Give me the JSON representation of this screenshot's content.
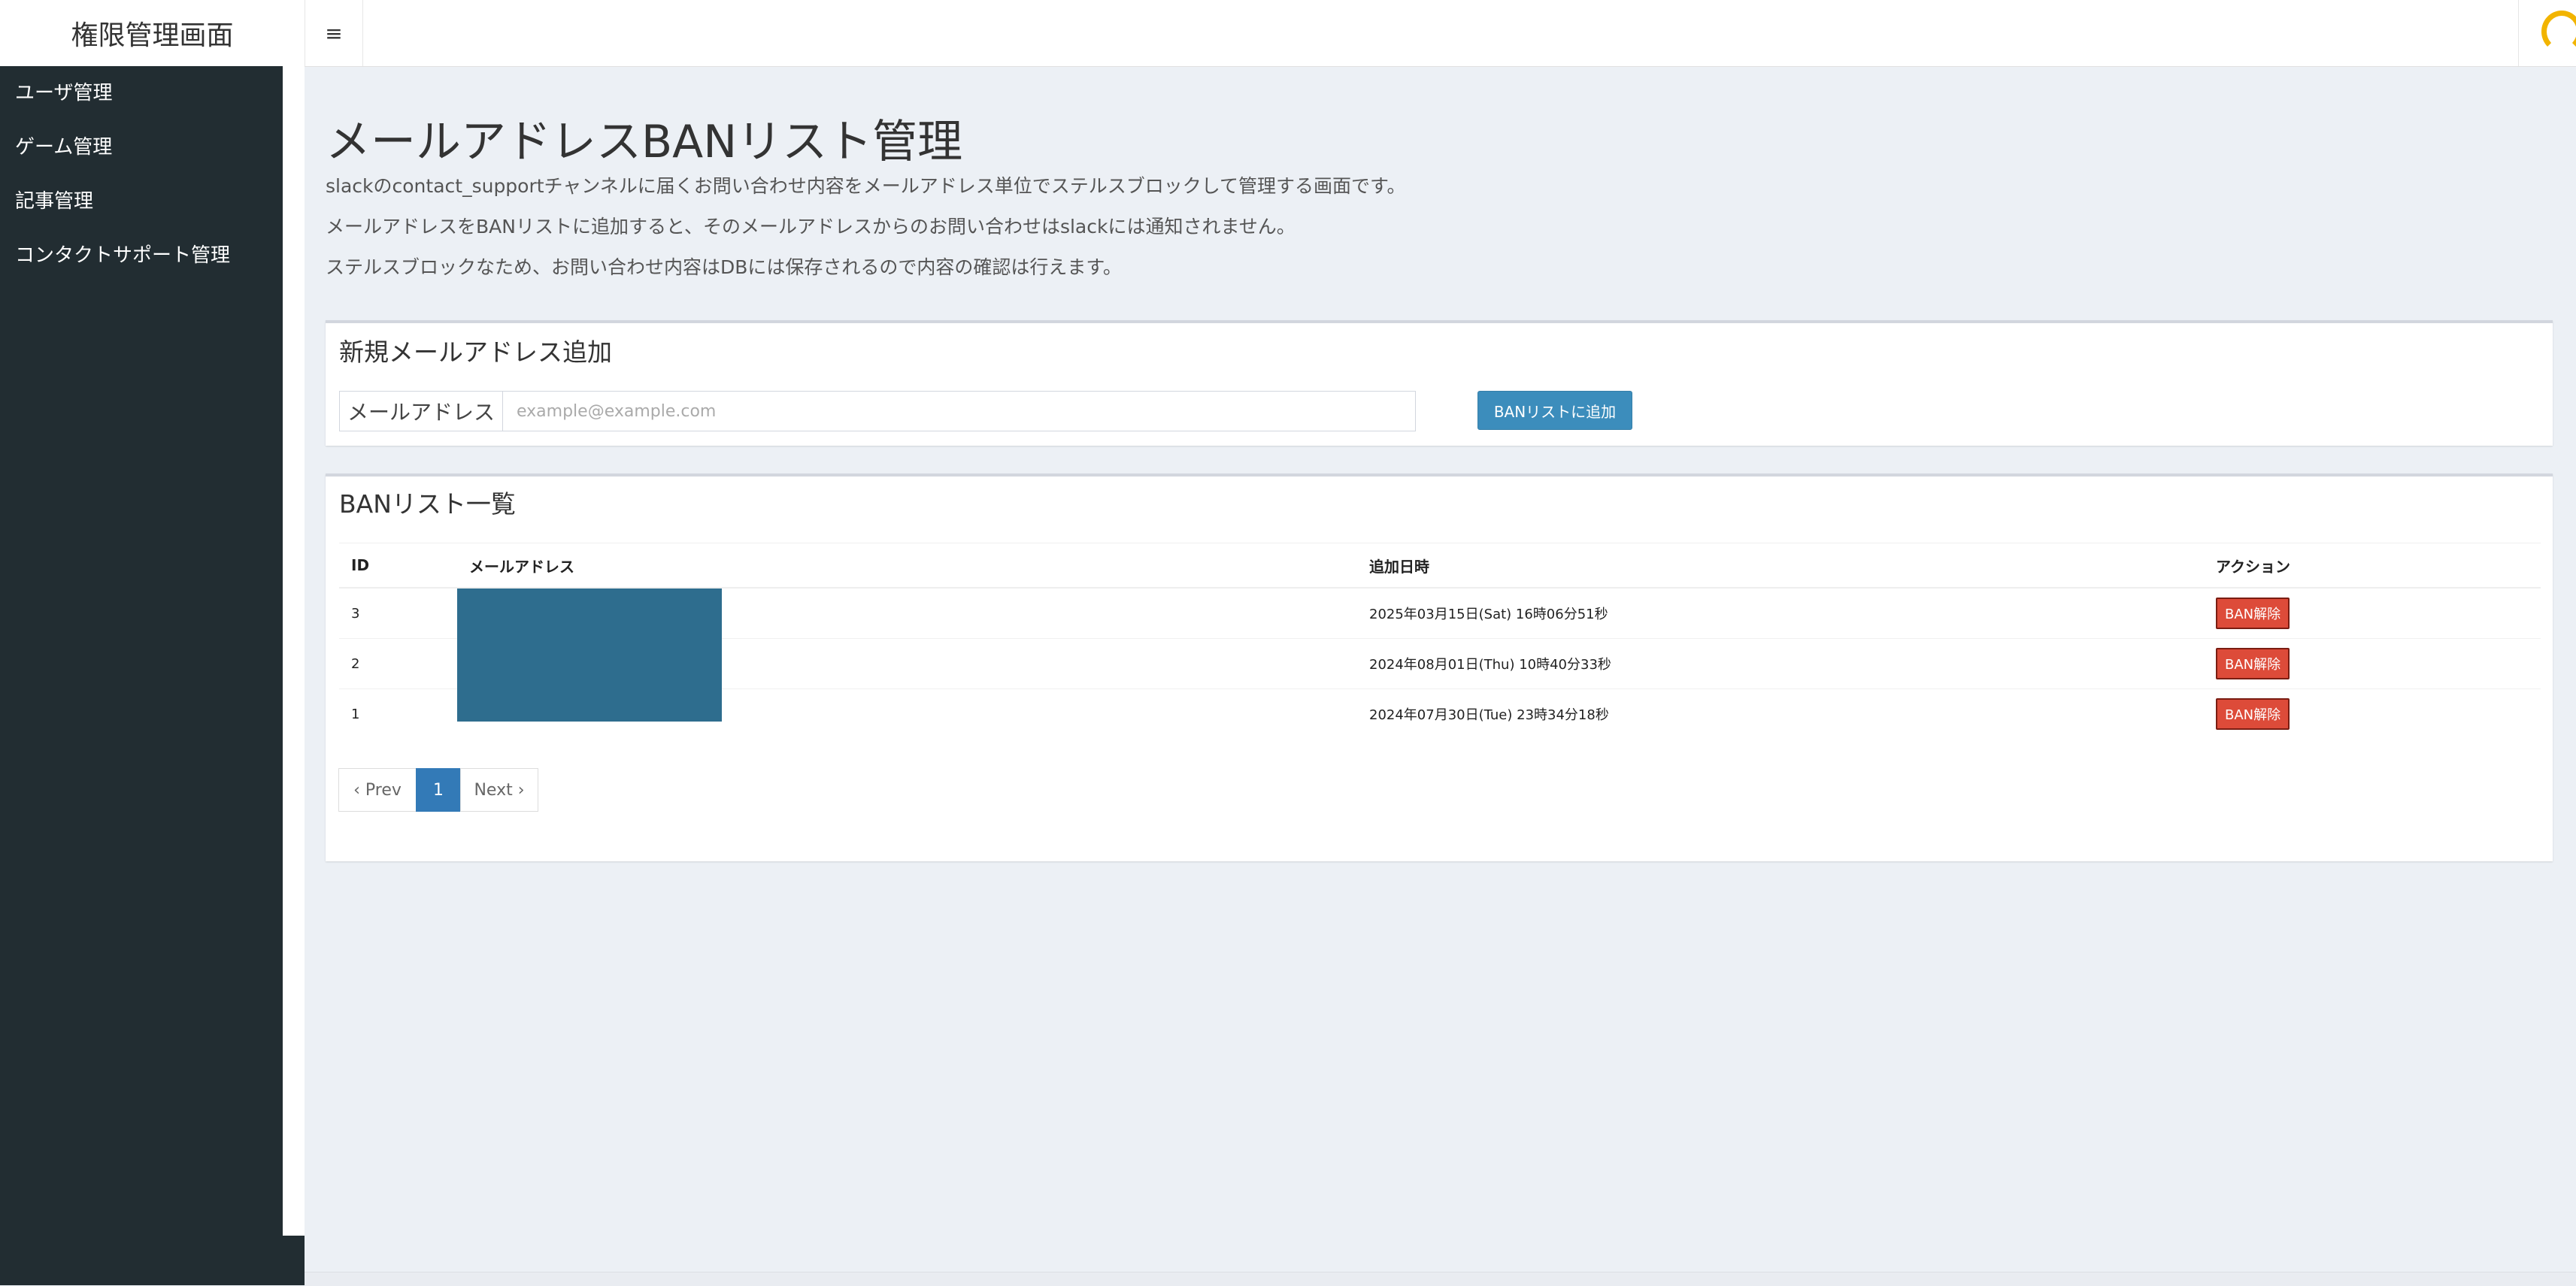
{
  "header": {
    "app_title": "権限管理画面",
    "menu_icon": "hamburger-icon"
  },
  "sidebar": {
    "items": [
      {
        "label": "ユーザ管理"
      },
      {
        "label": "ゲーム管理"
      },
      {
        "label": "記事管理"
      },
      {
        "label": "コンタクトサポート管理"
      }
    ]
  },
  "main": {
    "title": "メールアドレスBANリスト管理",
    "descriptions": [
      "slackのcontact_supportチャンネルに届くお問い合わせ内容をメールアドレス単位でステルスブロックして管理する画面です。",
      "メールアドレスをBANリストに追加すると、そのメールアドレスからのお問い合わせはslackには通知されません。",
      "ステルスブロックなため、お問い合わせ内容はDBには保存されるので内容の確認は行えます。"
    ],
    "add_box": {
      "title": "新規メールアドレス追加",
      "input_label": "メールアドレス",
      "input_placeholder": "example@example.com",
      "input_value": "",
      "submit_label": "BANリストに追加"
    },
    "list_box": {
      "title": "BANリスト一覧",
      "columns": [
        "ID",
        "メールアドレス",
        "追加日時",
        "アクション"
      ],
      "rows": [
        {
          "id": "3",
          "email": "",
          "added_at": "2025年03月15日(Sat) 16時06分51秒",
          "action": "BAN解除"
        },
        {
          "id": "2",
          "email": "",
          "added_at": "2024年08月01日(Thu) 10時40分33秒",
          "action": "BAN解除"
        },
        {
          "id": "1",
          "email": "",
          "added_at": "2024年07月30日(Tue) 23時34分18秒",
          "action": "BAN解除"
        }
      ],
      "pagination": {
        "prev": "‹ Prev",
        "current": "1",
        "next": "Next ›"
      }
    }
  },
  "colors": {
    "sidebar_bg": "#222d32",
    "primary": "#3c8dbc",
    "danger": "#dd4b39",
    "redacted": "#2e6d8e",
    "avatar_accent": "#f2b400"
  }
}
